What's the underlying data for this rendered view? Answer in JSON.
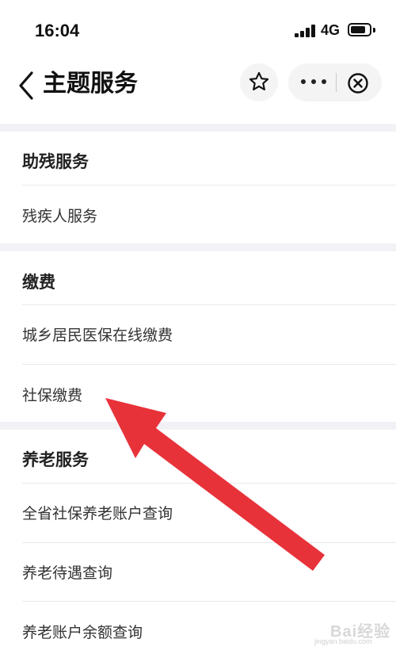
{
  "status_bar": {
    "time": "16:04",
    "network": "4G"
  },
  "nav": {
    "title": "主题服务"
  },
  "sections": [
    {
      "title": "助残服务",
      "items": [
        "残疾人服务"
      ]
    },
    {
      "title": "缴费",
      "items": [
        "城乡居民医保在线缴费",
        "社保缴费"
      ]
    },
    {
      "title": "养老服务",
      "items": [
        "全省社保养老账户查询",
        "养老待遇查询",
        "养老账户余额查询"
      ]
    }
  ],
  "watermark": {
    "text": "Bai经验",
    "sub": "jingyan.baidu.com"
  },
  "colors": {
    "arrow": "#e8323a",
    "section_gap": "#f2f2f6"
  },
  "icons": [
    "back-icon",
    "star-icon",
    "more-icon",
    "close-icon",
    "arrow-pointer-icon"
  ]
}
